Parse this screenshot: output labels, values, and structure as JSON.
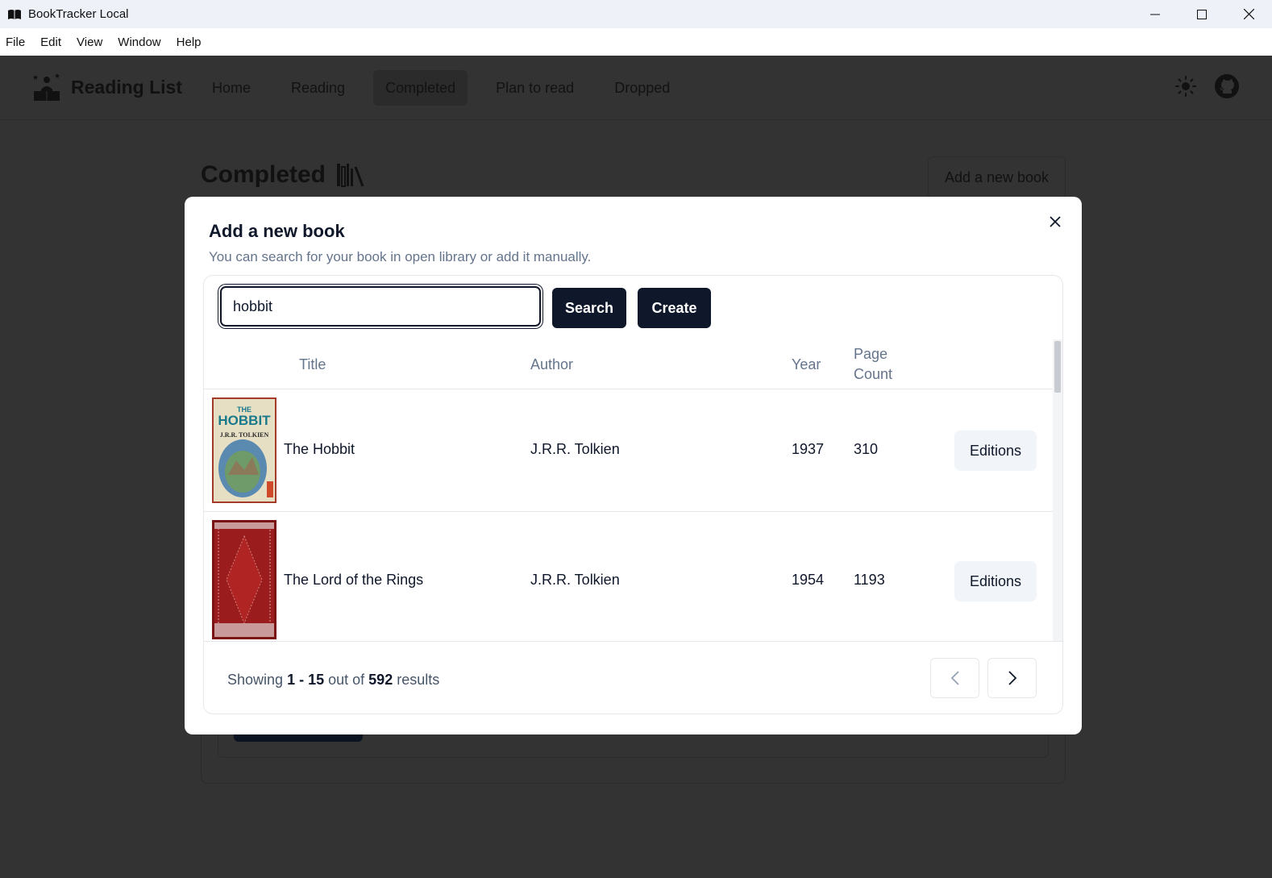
{
  "window": {
    "title": "BookTracker Local",
    "controls": [
      "minimize",
      "maximize",
      "close"
    ]
  },
  "menubar": {
    "items": [
      "File",
      "Edit",
      "View",
      "Window",
      "Help"
    ]
  },
  "header": {
    "brand": "Reading List",
    "nav": [
      {
        "label": "Home",
        "active": false
      },
      {
        "label": "Reading",
        "active": false
      },
      {
        "label": "Completed",
        "active": true
      },
      {
        "label": "Plan to read",
        "active": false
      },
      {
        "label": "Dropped",
        "active": false
      }
    ],
    "icons": [
      "sun-icon",
      "github-icon"
    ]
  },
  "page": {
    "title": "Completed",
    "add_button": "Add a new book"
  },
  "modal": {
    "title": "Add a new book",
    "description": "You can search for your book in open library or add it manually.",
    "search": {
      "value": "hobbit",
      "search_label": "Search",
      "create_label": "Create"
    },
    "table": {
      "columns": {
        "title": "Title",
        "author": "Author",
        "year": "Year",
        "page_count_1": "Page",
        "page_count_2": "Count"
      },
      "rows": [
        {
          "title": "The Hobbit",
          "author": "J.R.R. Tolkien",
          "year": "1937",
          "pages": "310",
          "action": "Editions",
          "cover_text_1": "THE",
          "cover_text_2": "HOBBIT",
          "cover_text_3": "J.R.R. TOLKIEN"
        },
        {
          "title": "The Lord of the Rings",
          "author": "J.R.R. Tolkien",
          "year": "1954",
          "pages": "1193",
          "action": "Editions"
        }
      ]
    },
    "footer": {
      "showing_prefix": "Showing",
      "range": "1 - 15",
      "out_of": "out of",
      "total": "592",
      "suffix": "results"
    }
  },
  "colors": {
    "overlay_background": "#333333",
    "primary_button": "#0f172a",
    "secondary_button": "#f1f5f9",
    "muted_text": "#64748b"
  }
}
